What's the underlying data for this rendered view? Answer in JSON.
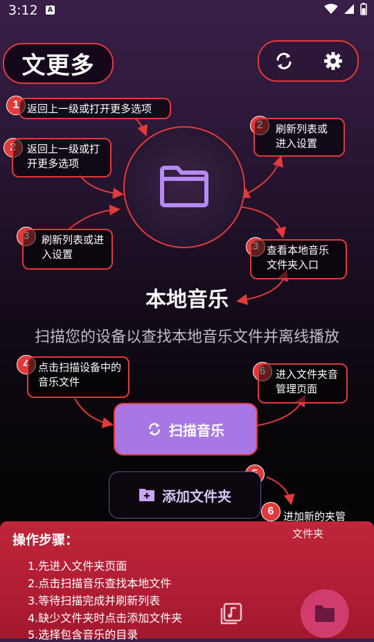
{
  "status_bar": {
    "time": "3:12",
    "badge": "A"
  },
  "app": {
    "title": "文更多"
  },
  "main": {
    "heading": "本地音乐",
    "subtitle": "扫描您的设备以查找本地音乐文件并离线播放",
    "scan_label": "扫描音乐",
    "add_folder_label": "添加文件夹"
  },
  "annotations": [
    {
      "number": "1",
      "text": "返回上一级或打开更多选项"
    },
    {
      "number": "2",
      "text": "返回上一级或打开更多选项"
    },
    {
      "number": "2",
      "text": "刷新列表或进入设置"
    },
    {
      "number": "3",
      "text": "刷新列表或进入设置"
    },
    {
      "number": "3",
      "text": "查看本地音乐文件夹入口"
    },
    {
      "number": "4",
      "text": "点击扫描设备中的音乐文件"
    },
    {
      "number": "6",
      "text": "进入文件夹音管理页面"
    },
    {
      "number": "5",
      "text": ""
    },
    {
      "number": "6",
      "text": "进加新的夹管"
    }
  ],
  "hint_extra": "文件夹",
  "steps": {
    "title": "操作步骤：",
    "items": [
      "1.先进入文件夹页面",
      "2.点击扫描音乐查找本地文件",
      "3.等待扫描完成并刷新列表",
      "4.缺少文件夹时点击添加文件夹",
      "5.选择包含音乐的目录"
    ]
  },
  "colors": {
    "accent": "#a877e6",
    "annotation": "#e23a3a",
    "panel": "#b81f34"
  },
  "icons": [
    "refresh-icon",
    "gear-icon",
    "folder-icon",
    "add-folder-icon",
    "music-library-icon",
    "wifi-icon",
    "signal-icon",
    "battery-icon"
  ]
}
